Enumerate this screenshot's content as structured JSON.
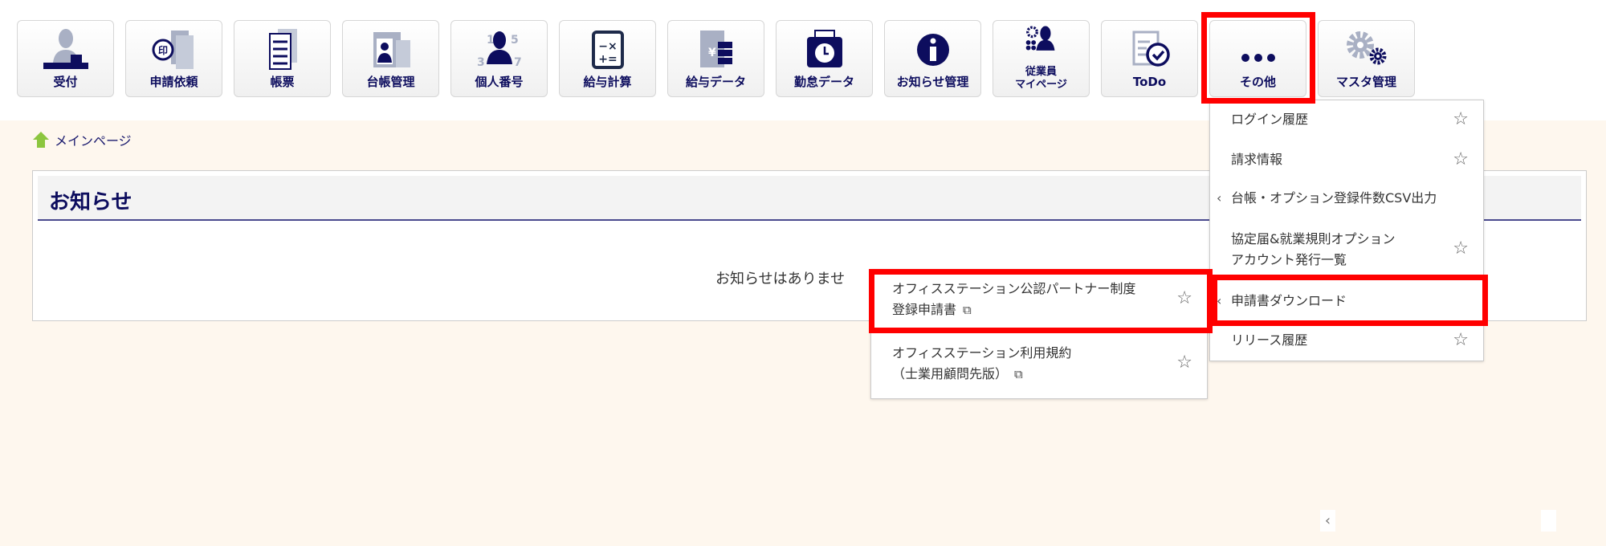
{
  "nav": [
    {
      "label": "受付",
      "icon": "reception-icon"
    },
    {
      "label": "申請依頼",
      "icon": "stamp-request-icon"
    },
    {
      "label": "帳票",
      "icon": "document-icon"
    },
    {
      "label": "台帳管理",
      "icon": "ledger-icon"
    },
    {
      "label": "個人番号",
      "icon": "personal-number-icon"
    },
    {
      "label": "給与計算",
      "icon": "calculator-icon"
    },
    {
      "label": "給与データ",
      "icon": "salary-data-icon"
    },
    {
      "label": "勤怠データ",
      "icon": "attendance-icon"
    },
    {
      "label": "お知らせ管理",
      "icon": "info-icon"
    },
    {
      "label": "従業員",
      "label2": "マイページ",
      "icon": "employee-icon"
    },
    {
      "label": "ToDo",
      "icon": "todo-icon"
    },
    {
      "label": "その他",
      "icon": "more-icon"
    },
    {
      "label": "マスタ管理",
      "icon": "gear-icon"
    }
  ],
  "personal_digits": [
    "1",
    "5",
    "3",
    "7"
  ],
  "breadcrumb": {
    "label": "メインページ"
  },
  "notice": {
    "title": "お知らせ",
    "empty": "お知らせはありませ"
  },
  "menu": {
    "items": [
      {
        "label": "ログイン履歴"
      },
      {
        "label": "請求情報"
      },
      {
        "label": "台帳・オプション登録件数CSV出力"
      },
      {
        "label": "協定届&就業規則オプション",
        "label2": "アカウント発行一覧"
      },
      {
        "label": "申請書ダウンロード"
      },
      {
        "label": "リリース履歴"
      }
    ]
  },
  "submenu": {
    "items": [
      {
        "label": "オフィスステーション公認パートナー制度",
        "label2": "登録申請書"
      },
      {
        "label": "オフィスステーション利用規約",
        "label2": "（士業用顧問先版）"
      }
    ]
  },
  "glyphs": {
    "star": "☆",
    "chevron": "‹",
    "external": "⧉",
    "prev": "‹"
  },
  "colors": {
    "navy": "#0d0d5e",
    "gray": "#a9b0c4",
    "highlight": "#ff0000",
    "background": "#fef7ee",
    "home": "#8cc63f"
  }
}
